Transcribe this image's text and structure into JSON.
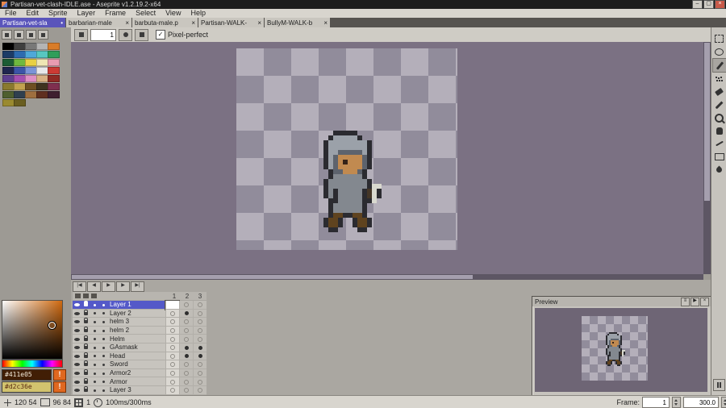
{
  "titlebar": {
    "title": "Partisan-vet-clash-IDLE.ase - Aseprite v1.2.19.2-x64",
    "minimize_glyph": "–",
    "maximize_glyph": "▢",
    "close_glyph": "×"
  },
  "menubar": {
    "items": [
      "File",
      "Edit",
      "Sprite",
      "Layer",
      "Frame",
      "Select",
      "View",
      "Help"
    ]
  },
  "tabbar": {
    "tabs": [
      {
        "label": "Partisan-vet-sla",
        "active": true,
        "close": "•"
      },
      {
        "label": "barbarian-male",
        "active": false,
        "close": "×"
      },
      {
        "label": "barbuta-male.p",
        "active": false,
        "close": "×"
      },
      {
        "label": "Partisan-WALK-",
        "active": false,
        "close": "×"
      },
      {
        "label": "BullyM-WALK-b",
        "active": false,
        "close": "×"
      }
    ]
  },
  "context_bar": {
    "size_value": "1",
    "check_glyph": "✓",
    "pixel_perfect_label": "Pixel-perfect"
  },
  "palette": {
    "colors": [
      "#000000",
      "#3f3f3f",
      "#787878",
      "#b4b4b4",
      "#d87c28",
      "#1c3b66",
      "#2d6bb0",
      "#4fa8d8",
      "#57c7c0",
      "#2f9e5a",
      "#1d5c34",
      "#6fb83f",
      "#e8d044",
      "#efe6b4",
      "#e89cb0",
      "#20264f",
      "#3b54a8",
      "#7a94d8",
      "#e8e8ea",
      "#cc3b34",
      "#5e3f8f",
      "#a44fb0",
      "#de8fc4",
      "#d8b184",
      "#8f2a24",
      "#8a7a2e",
      "#c2a24f",
      "#6e4f22",
      "#3f3320",
      "#7f2f4f",
      "#4f5f2f",
      "#2f3f4f",
      "#9f6f3f",
      "#5f2f1f",
      "#3f1f2f"
    ],
    "extra_colors": [
      "#9a8a30",
      "#6a5e20"
    ]
  },
  "color_selector": {
    "foreground_hex": "#411e05",
    "background_hex": "#d2c36e",
    "warning_glyph": "!"
  },
  "tools": [
    "rectangular-marquee",
    "lasso",
    "pencil",
    "spray",
    "eraser",
    "eyedropper",
    "zoom",
    "hand",
    "slice",
    "rectangle",
    "blur"
  ],
  "active_tool": "pencil",
  "timeline": {
    "playback_buttons": [
      "|◀",
      "◀",
      "▶",
      "▶",
      "▶|"
    ],
    "frames": [
      "1",
      "2",
      "3"
    ],
    "layers": [
      {
        "name": "Layer 1",
        "selected": true,
        "cels": [
          "selected",
          "empty",
          "empty"
        ]
      },
      {
        "name": "Layer 2",
        "selected": false,
        "cels": [
          "empty",
          "filled",
          "empty"
        ]
      },
      {
        "name": "helm 3",
        "selected": false,
        "cels": [
          "empty",
          "empty",
          "empty"
        ]
      },
      {
        "name": "helm 2",
        "selected": false,
        "cels": [
          "empty",
          "empty",
          "empty"
        ]
      },
      {
        "name": "Helm",
        "selected": false,
        "cels": [
          "empty",
          "empty",
          "empty"
        ]
      },
      {
        "name": "GAsmask",
        "selected": false,
        "cels": [
          "empty",
          "filled",
          "filled"
        ]
      },
      {
        "name": "Head",
        "selected": false,
        "cels": [
          "empty",
          "filled",
          "filled"
        ]
      },
      {
        "name": "Sword",
        "selected": false,
        "cels": [
          "empty",
          "empty",
          "empty"
        ]
      },
      {
        "name": "Armor2",
        "selected": false,
        "cels": [
          "empty",
          "empty",
          "empty"
        ]
      },
      {
        "name": "Armor",
        "selected": false,
        "cels": [
          "empty",
          "empty",
          "empty"
        ]
      },
      {
        "name": "Layer 3",
        "selected": false,
        "cels": [
          "empty",
          "empty",
          "empty"
        ]
      }
    ]
  },
  "preview": {
    "title": "Preview",
    "menu_glyph": "≡",
    "play_glyph": "▶",
    "close_glyph": "×"
  },
  "statusbar": {
    "position": "120 54",
    "sprite_size": "96 84",
    "zoom": "1",
    "timing": "100ms/300ms",
    "frame_label": "Frame:",
    "frame_value": "1",
    "duration_value": "300.0"
  },
  "sprite": {
    "scale_main": 6,
    "scale_preview": 2,
    "pixel_colors": {
      "d": "#2b2b30",
      "H": "#9ba1a9",
      "h": "#5d636d",
      "f": "#c18a50",
      "e": "#352318",
      "m": "#83888f",
      "g": "#443627",
      "s": "#d9d9cf",
      "b": "#5f431f"
    },
    "rows": [
      "....ddddd......",
      "...dHHHHHd.....",
      "..dHHHHHHHHd...",
      "..dHHHHHHHHd...",
      "..dHHhhhhhHd...",
      "..dHhfffffhd...",
      "..dHhfefffhd...",
      "..dHhfffffhd...",
      "...dhhfffhd....",
      "...dmmmmmmd....",
      "..dmmmmmmmmd...",
      "..dmmmmmmmmdss.",
      "..dmdmmmmmdgsd.",
      "..dmdmmmmmdgsd.",
      "...ddmmmmmdds..",
      "...dmmmmmmd....",
      "...dmmmmmmd....",
      "...dbbddbbd....",
      "..dbbd..dbbd...",
      "..dbbd..dbbd...",
      "...dd....dd...."
    ]
  }
}
